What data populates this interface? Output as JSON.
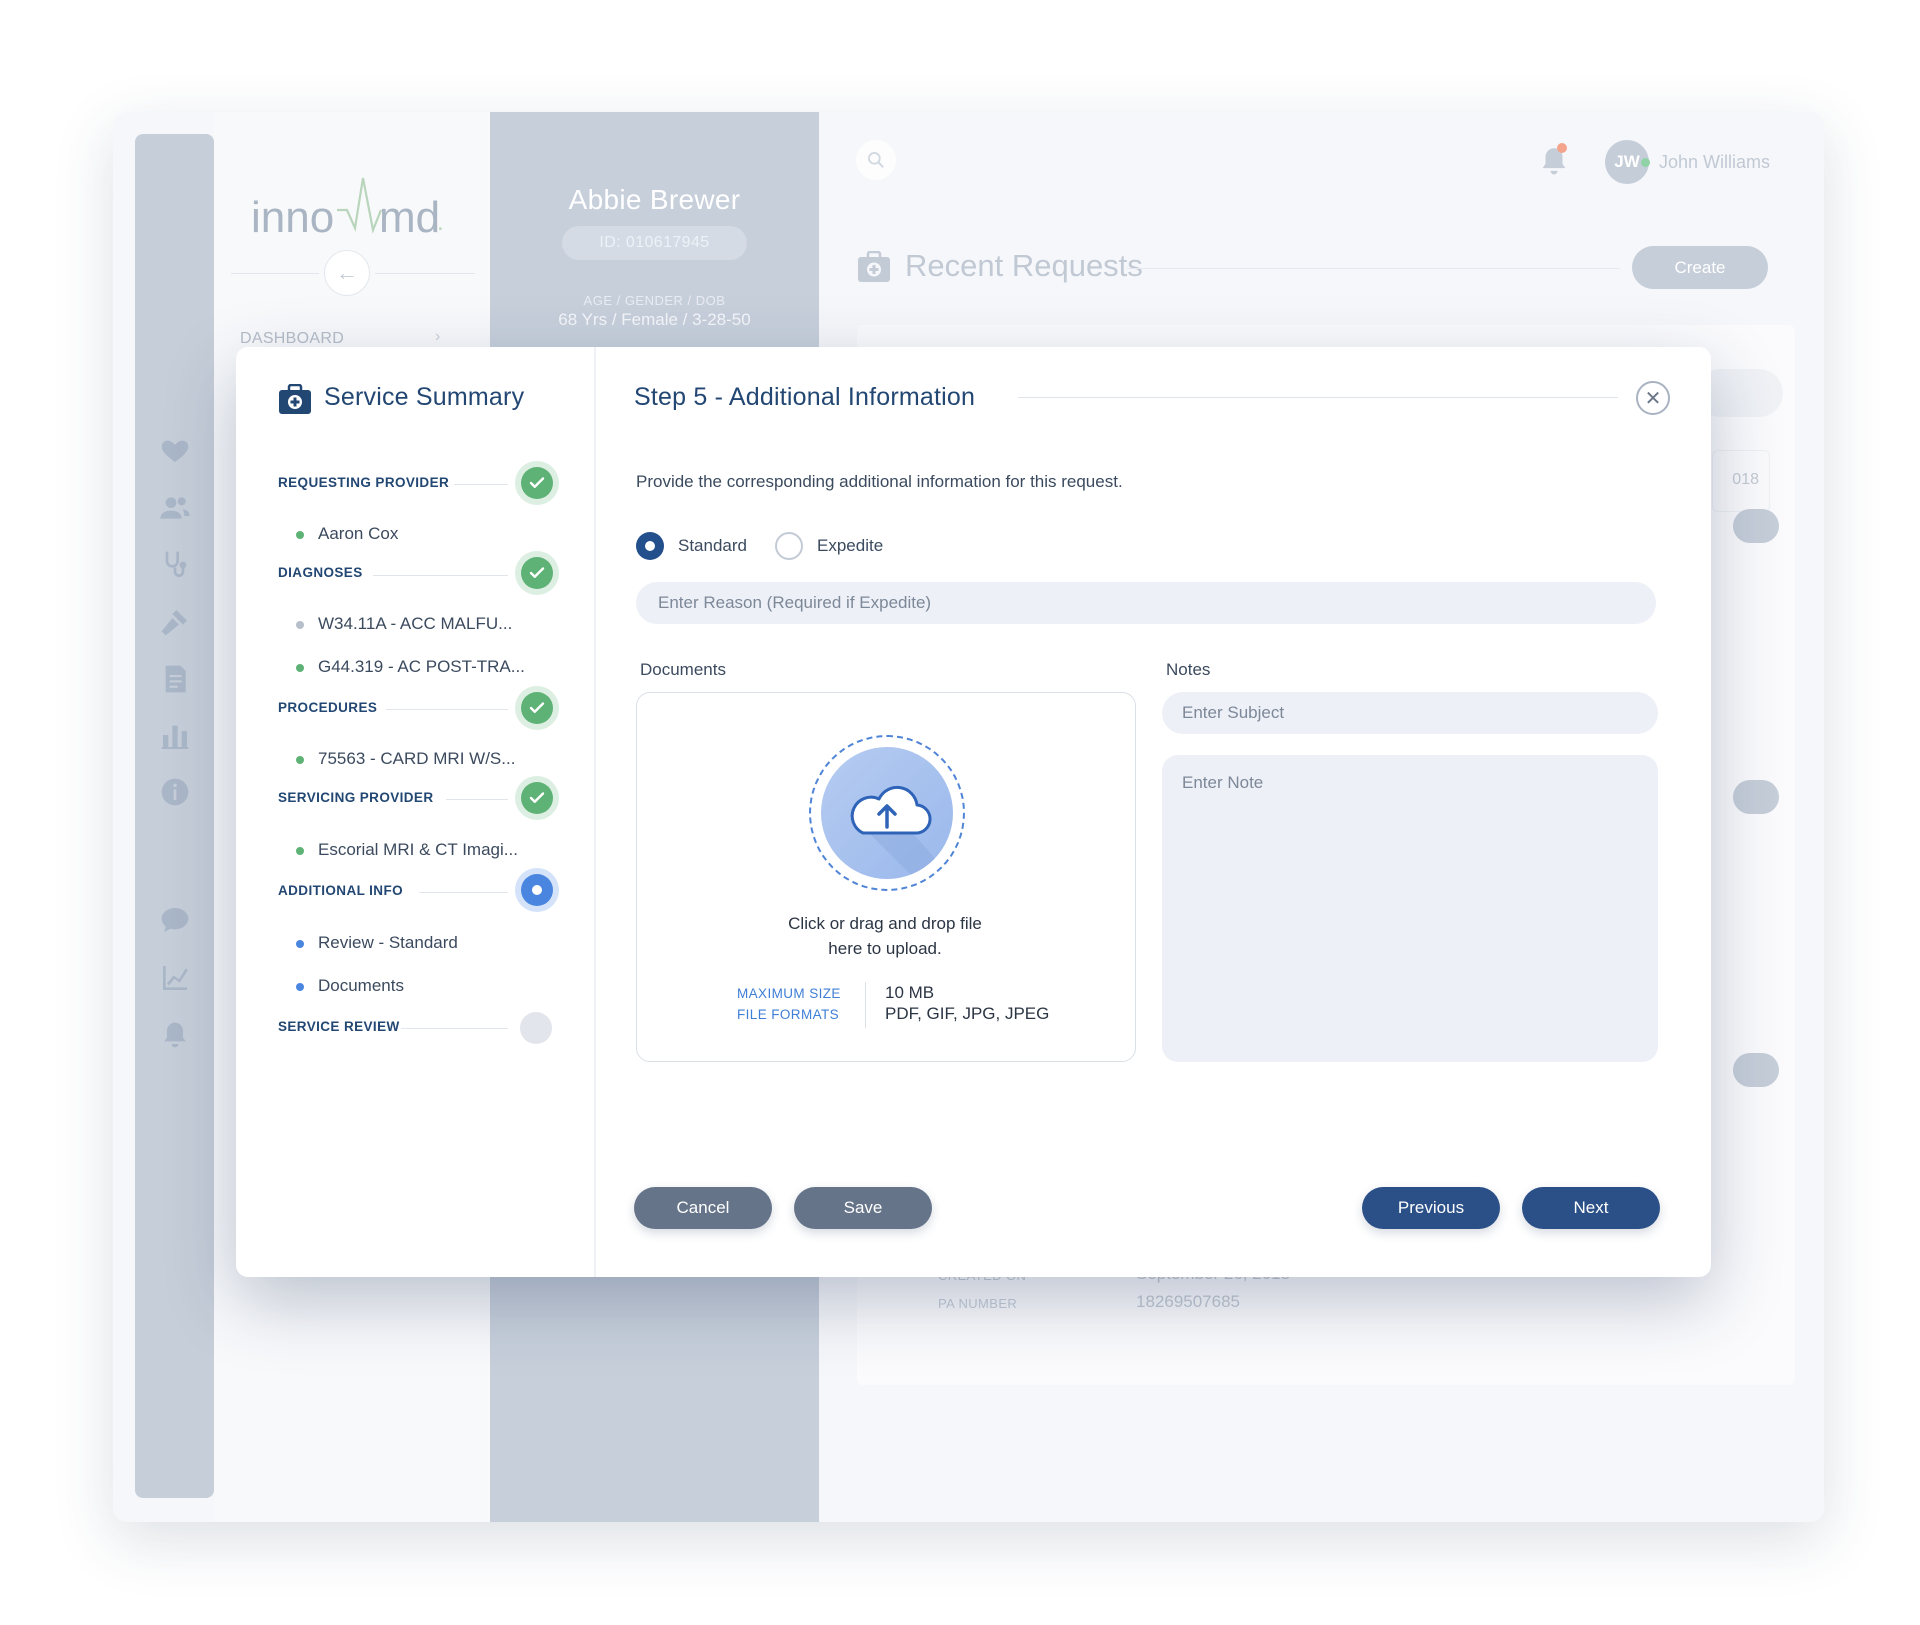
{
  "brand": {
    "logo_text": "innovamd"
  },
  "background": {
    "nav_dashboard": "DASHBOARD",
    "patient": {
      "name": "Abbie Brewer",
      "id": "ID:  010617945",
      "age_label": "AGE / GENDER / DOB",
      "age_value": "68 Yrs / Female / 3-28-50"
    },
    "header": {
      "user_initials": "JW",
      "user_name": "John Williams"
    },
    "recent": {
      "title": "Recent Requests",
      "create_label": "Create",
      "date_fragment": "018"
    },
    "details": {
      "created_label": "CREATED ON",
      "created_value": "September 26, 2018",
      "pa_label": "PA NUMBER",
      "pa_value": "18269507685"
    },
    "rail_icons": [
      "heart-pulse-icon",
      "users-icon",
      "stethoscope-icon",
      "gavel-icon",
      "document-icon",
      "bar-chart-icon",
      "info-icon",
      "chat-icon",
      "line-chart-icon",
      "bell-icon"
    ]
  },
  "summary": {
    "title": "Service Summary",
    "steps": [
      {
        "label": "REQUESTING PROVIDER",
        "status": "complete",
        "items": [
          "Aaron Cox"
        ]
      },
      {
        "label": "DIAGNOSES",
        "status": "complete",
        "items": [
          "W34.11A - ACC MALFU...",
          "G44.319 - AC POST-TRA..."
        ]
      },
      {
        "label": "PROCEDURES",
        "status": "complete",
        "items": [
          "75563 - CARD MRI W/S..."
        ]
      },
      {
        "label": "SERVICING PROVIDER",
        "status": "complete",
        "items": [
          "Escorial MRI & CT Imagi..."
        ]
      },
      {
        "label": "ADDITIONAL INFO",
        "status": "active",
        "items": [
          "Review - Standard",
          "Documents"
        ]
      },
      {
        "label": "SERVICE REVIEW",
        "status": "pending",
        "items": []
      }
    ]
  },
  "step": {
    "title": "Step 5 - Additional Information",
    "intro": "Provide the corresponding additional information for this request.",
    "priority_options": [
      {
        "label": "Standard",
        "selected": true
      },
      {
        "label": "Expedite",
        "selected": false
      }
    ],
    "reason_placeholder": "Enter Reason (Required if Expedite)",
    "documents_label": "Documents",
    "upload": {
      "line1": "Click or drag and drop file",
      "line2": "here to upload.",
      "max_size_label": "MAXIMUM SIZE",
      "max_size_value": "10 MB",
      "formats_label": "FILE FORMATS",
      "formats_value": "PDF, GIF, JPG, JPEG"
    },
    "notes_label": "Notes",
    "subject_placeholder": "Enter Subject",
    "note_placeholder": "Enter Note"
  },
  "actions": {
    "cancel": "Cancel",
    "save": "Save",
    "previous": "Previous",
    "next": "Next"
  },
  "colors": {
    "primary": "#2b5088",
    "success": "#5fb276",
    "active": "#4a86df",
    "muted_button": "#66748a"
  }
}
